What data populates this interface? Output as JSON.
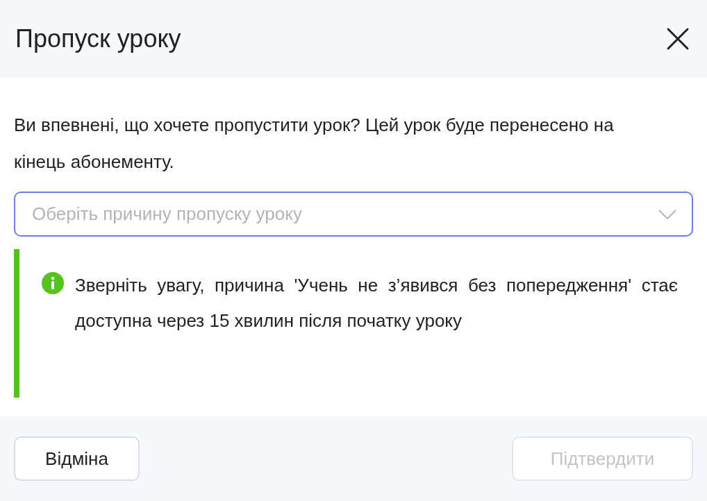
{
  "dialog": {
    "title": "Пропуск уроку",
    "message": "Ви впевнені, що хочете пропустити урок? Цей урок буде перенесено на кінець абонементу.",
    "reason_select": {
      "placeholder": "Оберіть причину пропуску уроку"
    },
    "notice": {
      "text": "Зверніть увагу, причина 'Учень не з’явився без попередження' стає доступна через 15 хвилин після початку уроку",
      "color": "#52c41a"
    },
    "buttons": [
      {
        "label": "Відміна",
        "disabled": false
      },
      {
        "label": "Підтвердити",
        "disabled": true
      }
    ]
  }
}
